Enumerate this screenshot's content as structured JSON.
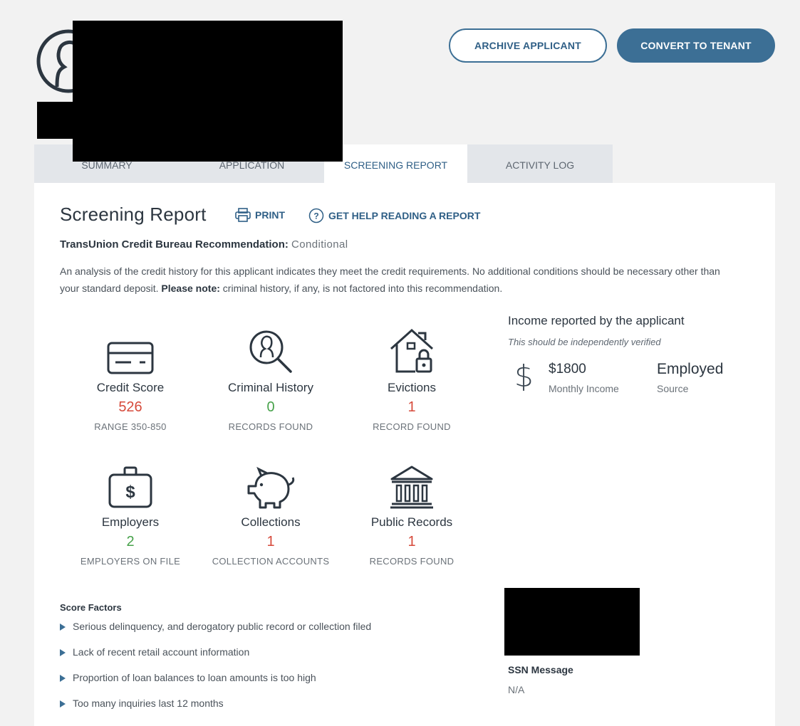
{
  "header": {
    "archive_label": "ARCHIVE APPLICANT",
    "convert_label": "CONVERT TO TENANT"
  },
  "tabs": [
    {
      "label": "SUMMARY",
      "active": false
    },
    {
      "label": "APPLICATION",
      "active": false
    },
    {
      "label": "SCREENING REPORT",
      "active": true
    },
    {
      "label": "ACTIVITY LOG",
      "active": false
    }
  ],
  "report": {
    "title": "Screening Report",
    "print_label": "PRINT",
    "help_label": "GET HELP READING A REPORT",
    "recommendation_label": "TransUnion Credit Bureau Recommendation:",
    "recommendation_value": "Conditional",
    "analysis_text": "An analysis of the credit history for this applicant indicates they meet the credit requirements. No additional conditions should be necessary other than your standard deposit.",
    "analysis_note_label": "Please note:",
    "analysis_note_text": "criminal history, if any, is not factored into this recommendation."
  },
  "stats": [
    {
      "label": "Credit Score",
      "value": "526",
      "sub": "RANGE 350-850",
      "color": "#d64a3b",
      "icon": "credit-card-icon"
    },
    {
      "label": "Criminal History",
      "value": "0",
      "sub": "RECORDS FOUND",
      "color": "#47a24a",
      "icon": "person-search-icon"
    },
    {
      "label": "Evictions",
      "value": "1",
      "sub": "RECORD FOUND",
      "color": "#d64a3b",
      "icon": "house-lock-icon"
    },
    {
      "label": "Employers",
      "value": "2",
      "sub": "EMPLOYERS ON FILE",
      "color": "#47a24a",
      "icon": "briefcase-dollar-icon"
    },
    {
      "label": "Collections",
      "value": "1",
      "sub": "COLLECTION ACCOUNTS",
      "color": "#d64a3b",
      "icon": "piggy-bank-icon"
    },
    {
      "label": "Public Records",
      "value": "1",
      "sub": "RECORDS FOUND",
      "color": "#d64a3b",
      "icon": "courthouse-icon"
    }
  ],
  "income": {
    "title": "Income reported by the applicant",
    "note": "This should be independently verified",
    "amount": "$1800",
    "amount_label": "Monthly Income",
    "source": "Employed",
    "source_label": "Source"
  },
  "score_factors": {
    "title": "Score Factors",
    "items": [
      "Serious delinquency, and derogatory public record or collection filed",
      "Lack of recent retail account information",
      "Proportion of loan balances to loan amounts is too high",
      "Too many inquiries last 12 months"
    ]
  },
  "ssn": {
    "title": "SSN Message",
    "value": "N/A"
  },
  "colors": {
    "accent": "#3c6f95",
    "bad": "#d64a3b",
    "good": "#47a24a"
  }
}
